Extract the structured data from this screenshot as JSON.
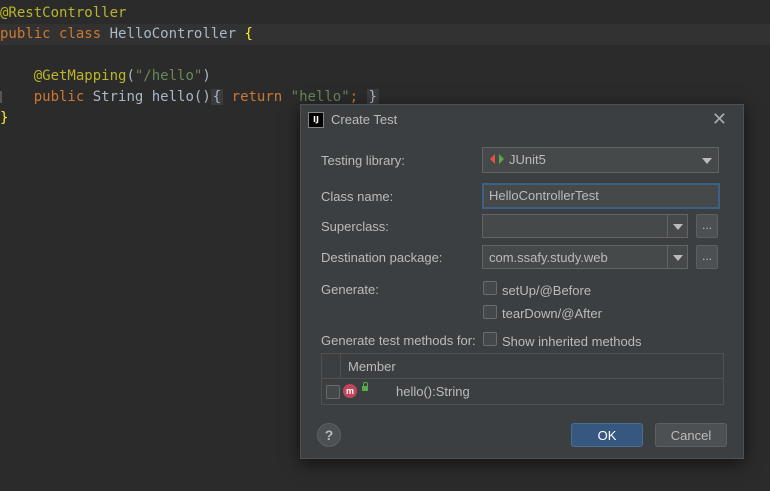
{
  "editor": {
    "line1": {
      "annotation": "@RestController"
    },
    "line2": {
      "kw1": "public",
      "kw2": "class",
      "name": "HelloController",
      "brace": "{"
    },
    "line4": {
      "annotation": "@GetMapping",
      "paren_open": "(",
      "path": "\"/hello\"",
      "paren_close": ")"
    },
    "line5": {
      "kw": "public",
      "type": "String",
      "method": "hello()",
      "fold_open": "{",
      "ret": "return",
      "value": "\"hello\"",
      "semi": ";",
      "fold_close": "}"
    },
    "line6": {
      "brace": "}"
    }
  },
  "dialog": {
    "title": "Create Test",
    "app_icon_text": "IJ",
    "testing_library": {
      "label": "Testing library:",
      "value": "JUnit5"
    },
    "class_name": {
      "label": "Class name:",
      "value": "HelloControllerTest"
    },
    "superclass": {
      "label": "Superclass:",
      "value": ""
    },
    "destination_package": {
      "label": "Destination package:",
      "value": "com.ssafy.study.web"
    },
    "generate": {
      "label": "Generate:",
      "options": [
        "setUp/@Before",
        "tearDown/@After"
      ]
    },
    "methods": {
      "label": "Generate test methods for:",
      "show_inherited": "Show inherited methods"
    },
    "table": {
      "header": "Member",
      "rows": [
        {
          "icon_text": "m",
          "member": "hello():String"
        }
      ]
    },
    "buttons": {
      "help": "?",
      "ok": "OK",
      "cancel": "Cancel",
      "dots": "..."
    }
  },
  "colors": {
    "accent": "#365880",
    "focus_border": "#3d6185",
    "method_icon": "#c0475b"
  }
}
